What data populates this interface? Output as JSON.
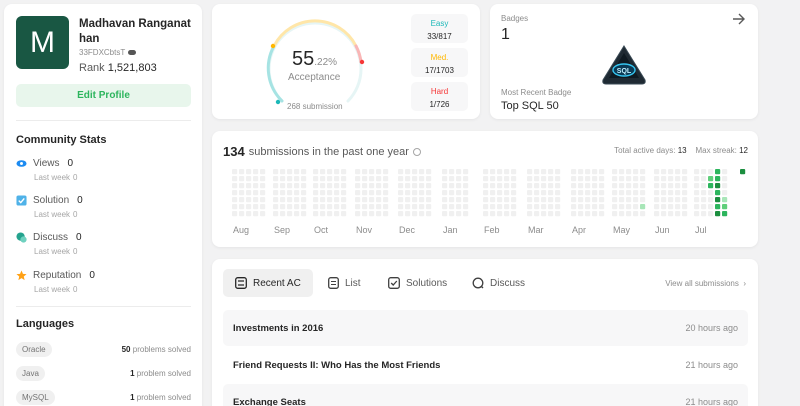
{
  "profile": {
    "avatar_letter": "M",
    "name": "Madhavan Ranganathan",
    "handle": "33FDXCbtsT",
    "rank_label": "Rank",
    "rank_value": "1,521,803",
    "edit_label": "Edit Profile"
  },
  "community": {
    "title": "Community Stats",
    "last_week_label": "Last week",
    "items": [
      {
        "label": "Views",
        "value": "0",
        "last_week": "0",
        "icon": "eye-icon",
        "color": "#1d8bf1"
      },
      {
        "label": "Solution",
        "value": "0",
        "last_week": "0",
        "icon": "check-square-icon",
        "color": "#4fb2e8"
      },
      {
        "label": "Discuss",
        "value": "0",
        "last_week": "0",
        "icon": "chat-icon",
        "color": "#24a38e"
      },
      {
        "label": "Reputation",
        "value": "0",
        "last_week": "0",
        "icon": "star-icon",
        "color": "#ffa116"
      }
    ]
  },
  "languages": {
    "title": "Languages",
    "solved_suffix_plural": "problems solved",
    "solved_suffix_singular": "problem solved",
    "items": [
      {
        "name": "Oracle",
        "count": "50",
        "suffix": "problems solved"
      },
      {
        "name": "Java",
        "count": "1",
        "suffix": "problem solved"
      },
      {
        "name": "MySQL",
        "count": "1",
        "suffix": "problem solved"
      }
    ]
  },
  "acceptance": {
    "percent_int": "55",
    "percent_dec": ".22%",
    "label": "Acceptance",
    "submissions": "268 submission",
    "difficulty": [
      {
        "name": "Easy",
        "count": "33/817",
        "color": "#1cb8b8"
      },
      {
        "name": "Med.",
        "count": "17/1703",
        "color": "#ffb700"
      },
      {
        "name": "Hard",
        "count": "1/726",
        "color": "#f63737"
      }
    ]
  },
  "badges": {
    "label": "Badges",
    "count": "1",
    "recent_label": "Most Recent Badge",
    "recent_name": "Top SQL 50",
    "badge_text": "SQL"
  },
  "heatmap": {
    "count": "134",
    "title_suffix": "submissions in the past one year",
    "total_active_label": "Total active days:",
    "total_active_value": "13",
    "max_streak_label": "Max streak:",
    "max_streak_value": "12",
    "months": [
      "Aug",
      "Sep",
      "Oct",
      "Nov",
      "Dec",
      "Jan",
      "Feb",
      "Mar",
      "Apr",
      "May",
      "Jun",
      "Jul"
    ],
    "colors": {
      "empty": "#f0f0f0",
      "l1": "#a8e6b8",
      "l2": "#5fcf7a",
      "l3": "#2cb55d",
      "l4": "#1b8e3f"
    }
  },
  "tabs": [
    {
      "label": "Recent AC",
      "active": true
    },
    {
      "label": "List",
      "active": false
    },
    {
      "label": "Solutions",
      "active": false
    },
    {
      "label": "Discuss",
      "active": false
    }
  ],
  "view_all": "View all submissions",
  "submissions": [
    {
      "title": "Investments in 2016",
      "time": "20 hours ago"
    },
    {
      "title": "Friend Requests II: Who Has the Most Friends",
      "time": "21 hours ago"
    },
    {
      "title": "Exchange Seats",
      "time": "21 hours ago"
    }
  ]
}
